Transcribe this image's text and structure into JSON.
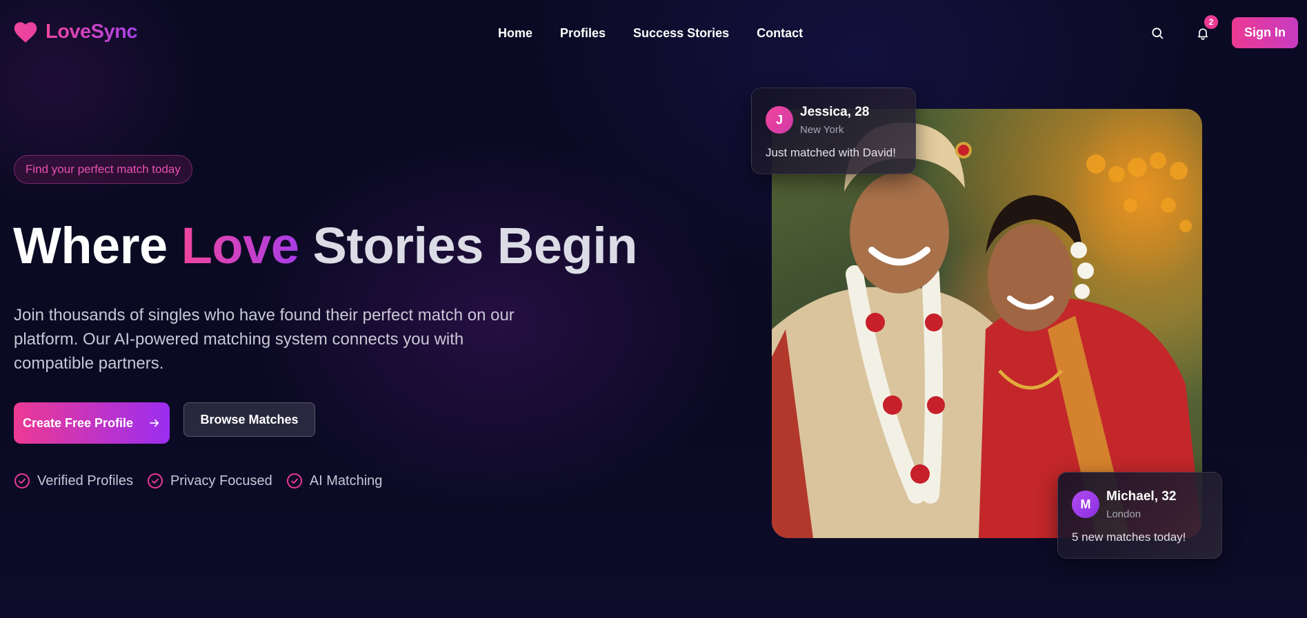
{
  "brand": {
    "name": "LoveSync"
  },
  "nav": {
    "links": [
      "Home",
      "Profiles",
      "Success Stories",
      "Contact"
    ],
    "notification_count": "2",
    "signin_label": "Sign In"
  },
  "hero": {
    "pill": "Find your perfect match today",
    "headline": {
      "part1": "Where ",
      "highlight": "Love",
      "part2": " Stories Begin"
    },
    "subtext": "Join thousands of singles who have found their perfect match on our platform. Our AI-powered matching system connects you with compatible partners.",
    "primary_cta": "Create Free Profile",
    "secondary_cta": "Browse Matches",
    "features": [
      "Verified Profiles",
      "Privacy Focused",
      "AI Matching"
    ]
  },
  "cards": {
    "top": {
      "initial": "J",
      "name": "Jessica, 28",
      "location": "New York",
      "message": "Just matched with David!"
    },
    "bottom": {
      "initial": "M",
      "name": "Michael, 32",
      "location": "London",
      "message": "5 new matches today!"
    }
  },
  "colors": {
    "accent_pink": "#ec3a93",
    "accent_purple": "#a642e8",
    "background": "#0b0a24"
  },
  "icons": [
    "heart-icon",
    "search-icon",
    "bell-icon",
    "arrow-right-icon",
    "check-circle-icon"
  ]
}
